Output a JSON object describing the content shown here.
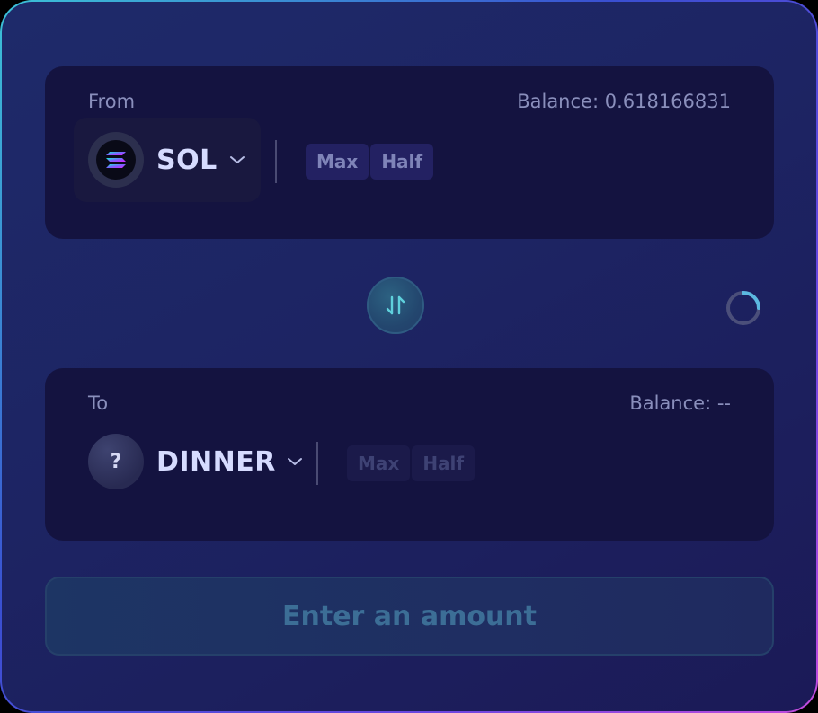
{
  "from": {
    "label": "From",
    "balance": "Balance: 0.618166831",
    "token": {
      "symbol": "SOL",
      "icon": "solana-logo-icon"
    },
    "quick_buttons": [
      "Max",
      "Half"
    ]
  },
  "to": {
    "label": "To",
    "balance": "Balance: --",
    "token": {
      "symbol": "DINNER",
      "icon_text": "?"
    },
    "quick_buttons": [
      "Max",
      "Half"
    ]
  },
  "swap": {
    "icon": "swap-direction-icon"
  },
  "loading": {
    "icon": "loading-spinner-icon"
  },
  "submit": {
    "label": "Enter an amount"
  },
  "colors": {
    "panel": "#1d2463",
    "box": "#141340",
    "accent": "#5aa9d6",
    "text_muted": "#8a8fbc"
  }
}
